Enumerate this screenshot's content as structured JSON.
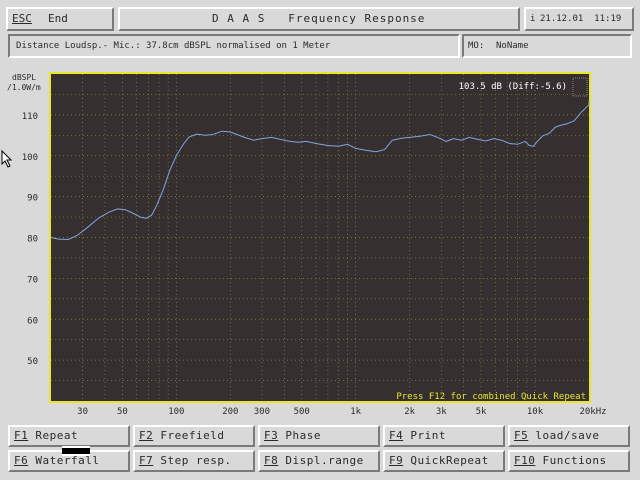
{
  "header": {
    "esc_key": "ESC",
    "esc_label": "End",
    "title": "D A A S   Frequency Response",
    "date_icon": "i",
    "datetime": "21.12.01  11:19"
  },
  "info": {
    "measurement": "Distance Loudsp.- Mic.: 37.8cm dBSPL normalised on 1 Meter",
    "name_label": "MO:",
    "name_value": "NoName"
  },
  "chart_data": {
    "type": "line",
    "title": "",
    "ylabel": "dBSPL /1.0W/m",
    "ylabel_lines": [
      "dBSPL",
      "/1.0W/m"
    ],
    "xlabel": "",
    "x_scale": "log",
    "xlim": [
      20,
      20000
    ],
    "ylim": [
      40,
      120
    ],
    "grid": true,
    "x_ticks": [
      {
        "value": 30,
        "label": "30"
      },
      {
        "value": 50,
        "label": "50"
      },
      {
        "value": 100,
        "label": "100"
      },
      {
        "value": 200,
        "label": "200"
      },
      {
        "value": 300,
        "label": "300"
      },
      {
        "value": 500,
        "label": "500"
      },
      {
        "value": 1000,
        "label": "1k"
      },
      {
        "value": 2000,
        "label": "2k"
      },
      {
        "value": 3000,
        "label": "3k"
      },
      {
        "value": 5000,
        "label": "5k"
      },
      {
        "value": 10000,
        "label": "10k"
      },
      {
        "value": 20000,
        "label": "20kHz"
      }
    ],
    "y_ticks": [
      {
        "value": 110,
        "label": "110"
      },
      {
        "value": 100,
        "label": "100"
      },
      {
        "value": 90,
        "label": "90"
      },
      {
        "value": 80,
        "label": "80"
      },
      {
        "value": 70,
        "label": "70"
      },
      {
        "value": 60,
        "label": "60"
      },
      {
        "value": 50,
        "label": "50"
      }
    ],
    "cursor_readout": "103.5 dB (Diff:-5.6)",
    "footer_note": "Press F12 for combined Quick Repeat",
    "series": [
      {
        "color": "#7fa6e0",
        "points": [
          [
            20,
            80
          ],
          [
            22,
            79.6
          ],
          [
            25,
            79.5
          ],
          [
            28,
            80.5
          ],
          [
            32,
            82.5
          ],
          [
            37,
            84.8
          ],
          [
            42,
            86.2
          ],
          [
            47,
            87
          ],
          [
            52,
            86.8
          ],
          [
            57,
            86
          ],
          [
            63,
            85
          ],
          [
            68,
            84.7
          ],
          [
            73,
            85.5
          ],
          [
            78,
            88
          ],
          [
            85,
            92
          ],
          [
            92,
            96.5
          ],
          [
            100,
            100
          ],
          [
            110,
            103
          ],
          [
            118,
            104.6
          ],
          [
            130,
            105.3
          ],
          [
            145,
            105
          ],
          [
            160,
            105.2
          ],
          [
            180,
            106
          ],
          [
            200,
            105.8
          ],
          [
            215,
            105.3
          ],
          [
            240,
            104.5
          ],
          [
            270,
            103.8
          ],
          [
            300,
            104.2
          ],
          [
            340,
            104.5
          ],
          [
            380,
            104
          ],
          [
            430,
            103.5
          ],
          [
            480,
            103.3
          ],
          [
            530,
            103.5
          ],
          [
            600,
            103
          ],
          [
            700,
            102.5
          ],
          [
            800,
            102.3
          ],
          [
            900,
            102.8
          ],
          [
            1000,
            101.8
          ],
          [
            1150,
            101.3
          ],
          [
            1300,
            101
          ],
          [
            1450,
            101.5
          ],
          [
            1600,
            103.8
          ],
          [
            1800,
            104.3
          ],
          [
            2000,
            104.5
          ],
          [
            2300,
            104.8
          ],
          [
            2600,
            105.2
          ],
          [
            2900,
            104.4
          ],
          [
            3200,
            103.5
          ],
          [
            3500,
            104.2
          ],
          [
            3900,
            103.8
          ],
          [
            4300,
            104.5
          ],
          [
            4800,
            104
          ],
          [
            5300,
            103.6
          ],
          [
            5900,
            104.2
          ],
          [
            6500,
            103.8
          ],
          [
            7200,
            103
          ],
          [
            8000,
            102.8
          ],
          [
            8800,
            103.5
          ],
          [
            9300,
            102.5
          ],
          [
            9800,
            102.3
          ],
          [
            10300,
            103.5
          ],
          [
            11000,
            104.8
          ],
          [
            12000,
            105.5
          ],
          [
            13000,
            107
          ],
          [
            14000,
            107.5
          ],
          [
            15000,
            107.8
          ],
          [
            16500,
            108.5
          ],
          [
            18000,
            110.5
          ],
          [
            20000,
            112.5
          ],
          [
            22000,
            113.5
          ]
        ]
      }
    ]
  },
  "fkeys": [
    {
      "key": "F1",
      "label": " Repeat"
    },
    {
      "key": "F2",
      "label": " Freefield"
    },
    {
      "key": "F3",
      "label": " Phase"
    },
    {
      "key": "F4",
      "label": " Print"
    },
    {
      "key": "F5",
      "label": " load/save"
    },
    {
      "key": "F6",
      "label": " Waterfall"
    },
    {
      "key": "F7",
      "label": " Step resp."
    },
    {
      "key": "F8",
      "label": " Displ.range"
    },
    {
      "key": "F9",
      "label": " QuickRepeat"
    },
    {
      "key": "F10",
      "label": " Functions"
    }
  ]
}
